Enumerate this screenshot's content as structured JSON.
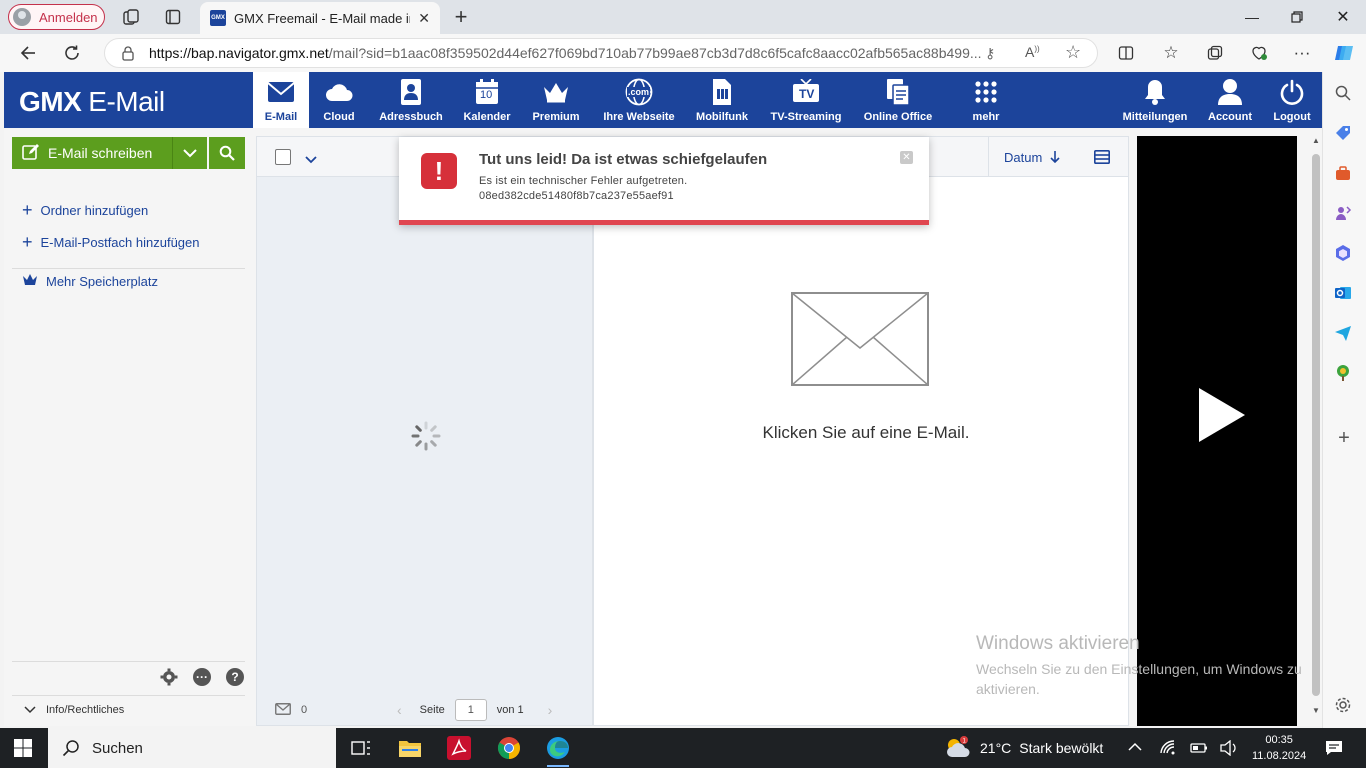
{
  "browser": {
    "profile_label": "Anmelden",
    "tab_title": "GMX Freemail - E-Mail made in G",
    "tab_favicon_text": "GMX",
    "url_host": "https://bap.navigator.gmx.net",
    "url_rest": "/mail?sid=b1aac08f359502d44ef627f069bd710ab77b99ae87cb3d7d8c6f5cafc8aacc02afb565ac88b499..."
  },
  "gmx": {
    "logo_brand": "GMX",
    "logo_product": "E-Mail",
    "nav": [
      {
        "label": "E-Mail",
        "icon": "envelope-icon"
      },
      {
        "label": "Cloud",
        "icon": "cloud-icon"
      },
      {
        "label": "Adressbuch",
        "icon": "addressbook-icon"
      },
      {
        "label": "Kalender",
        "icon": "calendar-icon",
        "day": "10"
      },
      {
        "label": "Premium",
        "icon": "crown-icon"
      },
      {
        "label": "Ihre Webseite",
        "icon": "globe-icon",
        "badge": ".com"
      },
      {
        "label": "Mobilfunk",
        "icon": "sim-icon"
      },
      {
        "label": "TV-Streaming",
        "icon": "tv-icon",
        "badge": "TV"
      },
      {
        "label": "Online Office",
        "icon": "office-icon"
      },
      {
        "label": "mehr",
        "icon": "grid-icon"
      },
      {
        "label": "Mitteilungen",
        "icon": "bell-icon"
      },
      {
        "label": "Account",
        "icon": "user-icon"
      },
      {
        "label": "Logout",
        "icon": "power-icon"
      }
    ]
  },
  "sidebar": {
    "compose_label": "E-Mail schreiben",
    "add_folder": "Ordner hinzufügen",
    "add_mailbox": "E-Mail-Postfach hinzufügen",
    "more_storage": "Mehr Speicherplatz",
    "footer_label": "Info/Rechtliches"
  },
  "mail_list": {
    "count": "0",
    "page_label": "Seite",
    "page_value": "1",
    "of_label": "von 1"
  },
  "reading_pane": {
    "sort_label": "Datum",
    "empty_text": "Klicken Sie auf eine E-Mail."
  },
  "error_toast": {
    "title": "Tut uns leid! Da ist etwas schiefgelaufen",
    "message": "Es ist ein technischer Fehler aufgetreten.",
    "code": "08ed382cde51480f8b7ca237e55aef91"
  },
  "watermark": {
    "title": "Windows aktivieren",
    "line1": "Wechseln Sie zu den Einstellungen, um Windows zu",
    "line2": "aktivieren."
  },
  "taskbar": {
    "search_label": "Suchen",
    "temperature": "21°C",
    "weather": "Stark bewölkt",
    "time": "00:35",
    "date": "11.08.2024"
  },
  "colors": {
    "gmx_blue": "#1c449b",
    "compose_green": "#5c9e1e",
    "error_red": "#d6303a"
  }
}
